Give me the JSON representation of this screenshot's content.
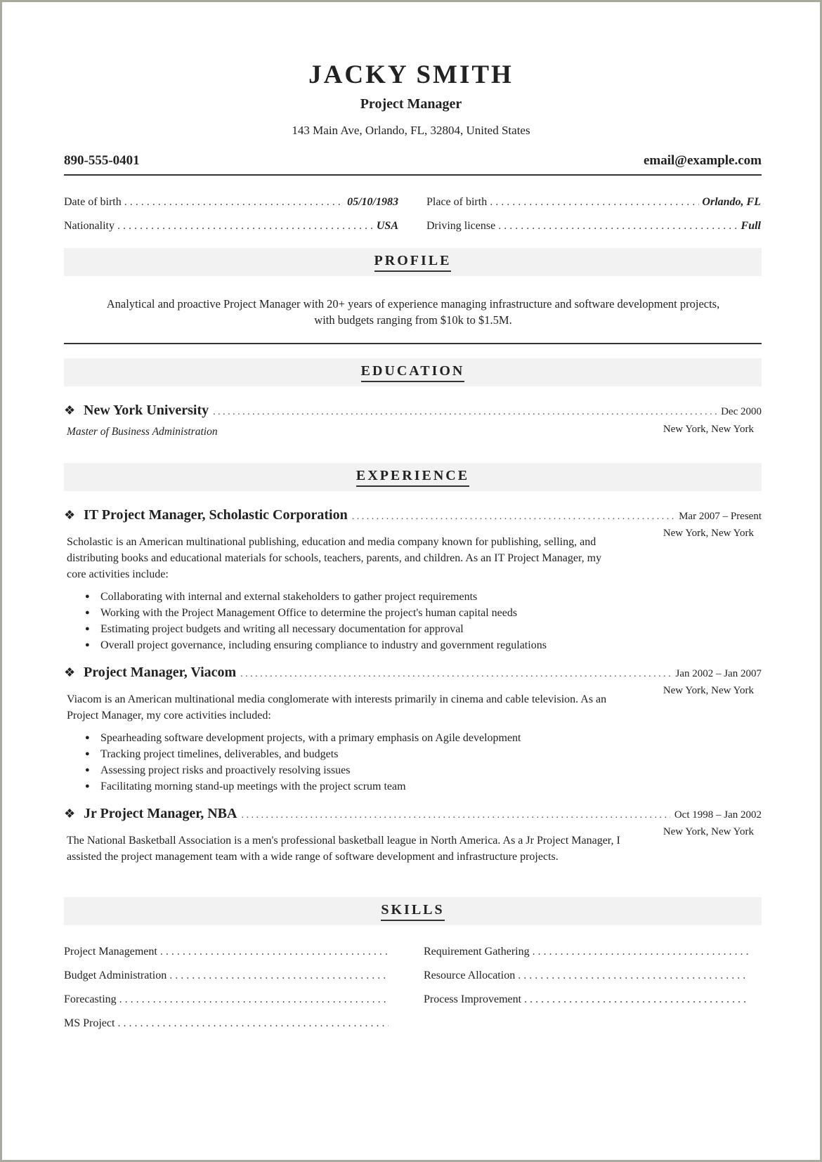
{
  "header": {
    "name": "JACKY SMITH",
    "title": "Project Manager",
    "address": "143 Main Ave, Orlando, FL, 32804, United States",
    "phone": "890-555-0401",
    "email": "email@example.com"
  },
  "personal_info": [
    {
      "label": "Date of birth",
      "value": "05/10/1983"
    },
    {
      "label": "Place of birth",
      "value": "Orlando, FL"
    },
    {
      "label": "Nationality",
      "value": "USA"
    },
    {
      "label": "Driving license",
      "value": "Full"
    }
  ],
  "sections": {
    "profile": "PROFILE",
    "education": "EDUCATION",
    "experience": "EXPERIENCE",
    "skills": "SKILLS"
  },
  "profile": {
    "text": "Analytical and proactive Project Manager with 20+ years of experience managing infrastructure and software development projects, with budgets ranging from $10k to $1.5M."
  },
  "education": [
    {
      "school": "New York University",
      "date": "Dec 2000",
      "location": "New York, New York",
      "degree": "Master of Business Administration"
    }
  ],
  "experience": [
    {
      "title": "IT Project Manager, Scholastic Corporation",
      "date": "Mar 2007 – Present",
      "location": "New York, New York",
      "description": "Scholastic is an American multinational publishing, education and media company known for publishing, selling, and distributing books and educational materials for schools, teachers, parents, and children. As an IT Project Manager, my core activities include:",
      "bullets": [
        "Collaborating with internal and external stakeholders to gather project requirements",
        "Working with the Project Management Office to determine the project's human capital needs",
        "Estimating project budgets and writing all necessary documentation for approval",
        "Overall project governance, including ensuring compliance to industry and government regulations"
      ]
    },
    {
      "title": "Project Manager, Viacom",
      "date": "Jan 2002 – Jan 2007",
      "location": "New York, New York",
      "description": "Viacom is an American multinational media conglomerate with interests primarily in cinema and cable television. As an Project Manager, my core activities included:",
      "bullets": [
        "Spearheading software development projects, with a primary emphasis on Agile development",
        "Tracking project timelines, deliverables, and budgets",
        "Assessing project risks and proactively resolving issues",
        "Facilitating morning stand-up meetings with the project scrum team"
      ]
    },
    {
      "title": "Jr Project Manager, NBA",
      "date": "Oct 1998 – Jan 2002",
      "location": "New York, New York",
      "description": "The National Basketball Association is a men's professional basketball league in North America. As a Jr Project Manager, I assisted the project management team with a wide range of software development and infrastructure projects."
    }
  ],
  "skills": [
    "Project Management",
    "Requirement Gathering",
    "Budget Administration",
    "Resource Allocation",
    "Forecasting",
    "Process Improvement",
    "MS Project"
  ],
  "icons": {
    "entry_bullet": "four-diamond-icon",
    "list_bullet": "bullet-dot-icon"
  },
  "colors": {
    "border": "#a8ab9c",
    "section_bg": "#f2f2f2",
    "text": "#222222"
  }
}
